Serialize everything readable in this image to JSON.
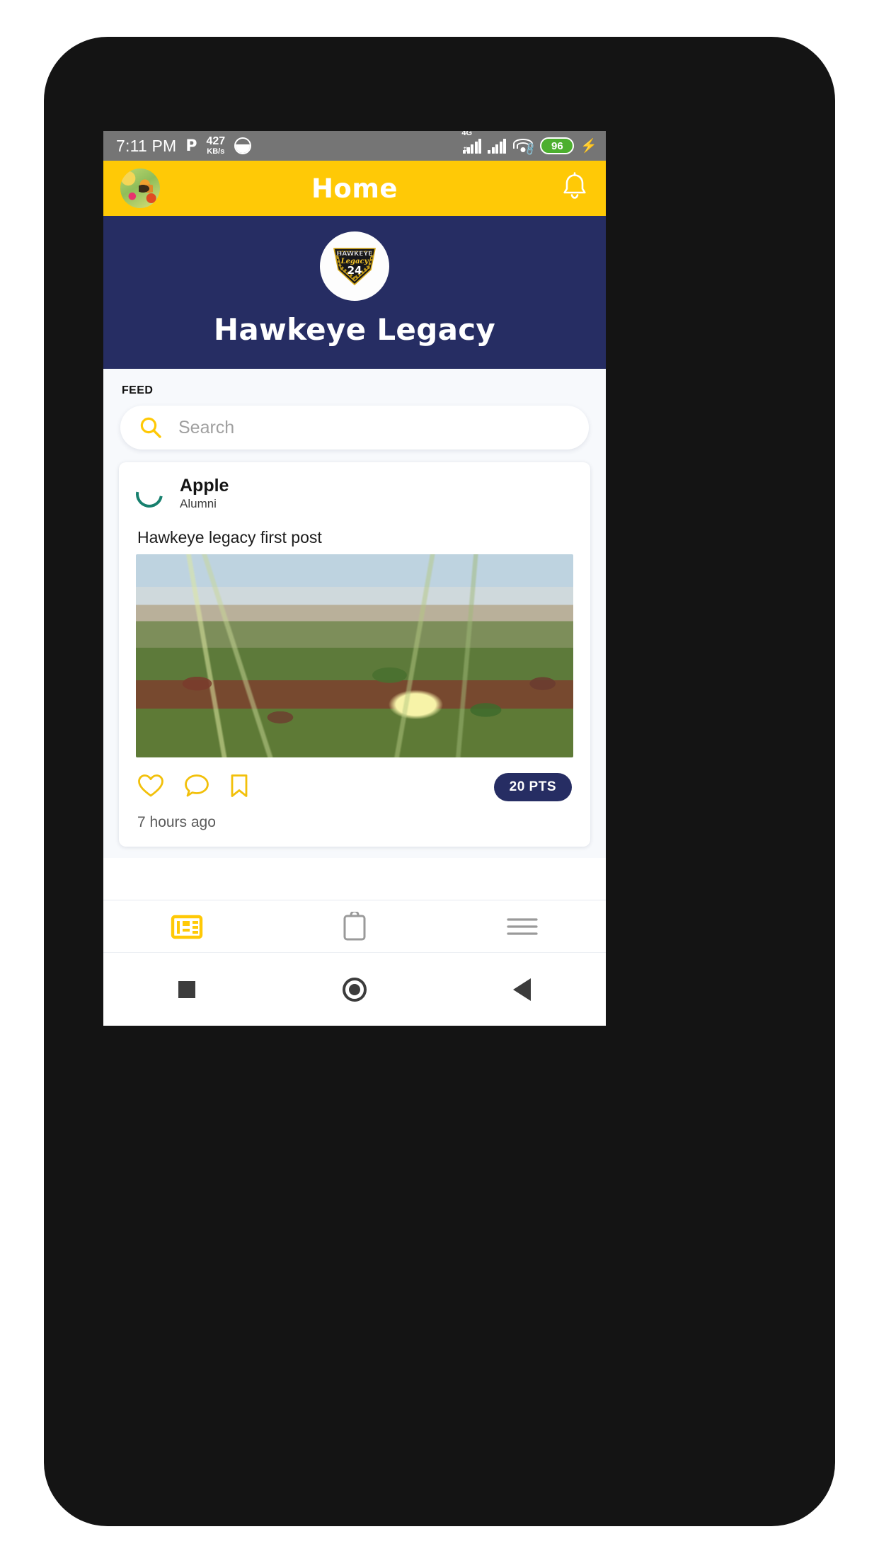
{
  "status_bar": {
    "time": "7:11 PM",
    "p_icon": "P",
    "data_rate_value": "427",
    "data_rate_unit": "KB/s",
    "app_icon": "face-circle-icon",
    "network_type": "4G",
    "network_arrows": "⇅",
    "wifi_icon": "wifi-icon",
    "wifi_link_icon": "🔗",
    "battery_level": "96",
    "battery_color": "#4caf2f",
    "charging_icon": "⚡"
  },
  "app_bar": {
    "avatar_label": "user-avatar",
    "title": "Home",
    "notification_icon": "bell-icon",
    "background_color": "#ffc906"
  },
  "hero": {
    "logo_alt": "hawkeye-legacy-logo",
    "logo_word_top": "HAWKEYE",
    "logo_word_script": "Legacy",
    "logo_number": "24",
    "title": "Hawkeye Legacy",
    "background_color": "#262d63"
  },
  "feed": {
    "section_label": "FEED",
    "search": {
      "placeholder": "Search",
      "value": "",
      "icon": "search-icon",
      "icon_color": "#ffc906"
    },
    "posts": [
      {
        "avatar_state": "loading-spinner",
        "avatar_color": "#17806e",
        "author": "Apple",
        "role": "Alumni",
        "text": "Hawkeye legacy first post",
        "image_alt": "beach-dune-ice-plant-flower-photo",
        "actions": [
          {
            "name": "like",
            "icon": "heart-icon"
          },
          {
            "name": "comment",
            "icon": "comment-bubble-icon"
          },
          {
            "name": "save",
            "icon": "bookmark-icon"
          }
        ],
        "points_badge": "20 PTS",
        "points_badge_color": "#262d63",
        "timestamp": "7 hours ago"
      }
    ]
  },
  "bottom_nav": {
    "items": [
      {
        "name": "feed",
        "icon": "newspaper-icon",
        "active": true,
        "color": "#ffc906"
      },
      {
        "name": "tasks",
        "icon": "clipboard-icon",
        "active": false,
        "color": "#9a9a9a"
      },
      {
        "name": "menu",
        "icon": "hamburger-menu-icon",
        "active": false,
        "color": "#9a9a9a"
      }
    ]
  },
  "system_nav": {
    "recents_icon": "square-icon",
    "home_icon": "circle-icon",
    "back_icon": "triangle-back-icon"
  }
}
